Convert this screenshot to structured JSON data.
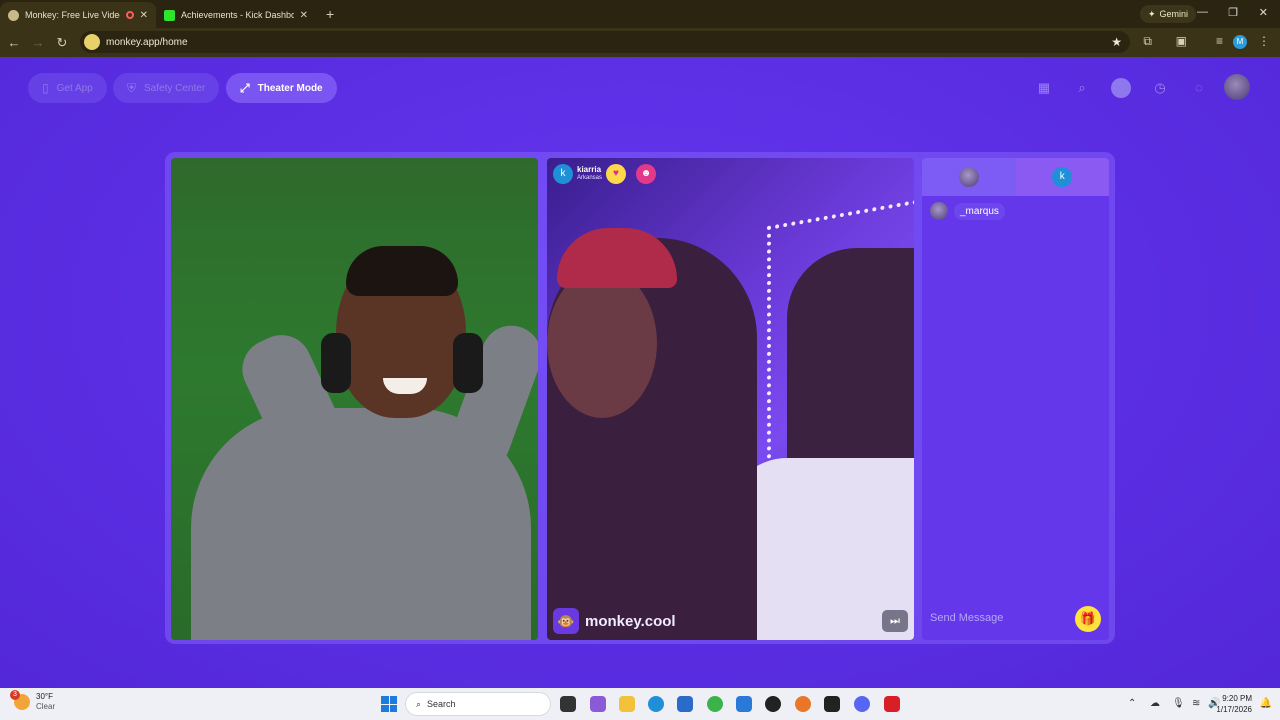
{
  "browser": {
    "tabs": [
      {
        "title": "Monkey: Free Live Video Chat",
        "active": true
      },
      {
        "title": "Achievements - Kick Dashboard",
        "active": false
      }
    ],
    "gemini_label": "Gemini",
    "url": "monkey.app/home",
    "profile_initial": "M"
  },
  "header": {
    "get_app": "Get App",
    "safety_center": "Safety Center",
    "theater_mode": "Theater Mode"
  },
  "remote_user": {
    "initial": "k",
    "name": "kiarria",
    "location": "Arkansas"
  },
  "brand": {
    "name": "monkey.cool"
  },
  "chat": {
    "tab_user_initial": "k",
    "messages": [
      {
        "user": "_marqus"
      }
    ],
    "input_placeholder": "Send Message"
  },
  "taskbar": {
    "weather_temp": "30°F",
    "weather_cond": "Clear",
    "weather_badge": "3",
    "search_placeholder": "Search",
    "time": "9:20 PM",
    "date": "1/17/2026"
  },
  "colors": {
    "page_bg": "#5b2fe6",
    "accent": "#7a55f2",
    "gift": "#ffe23a"
  }
}
